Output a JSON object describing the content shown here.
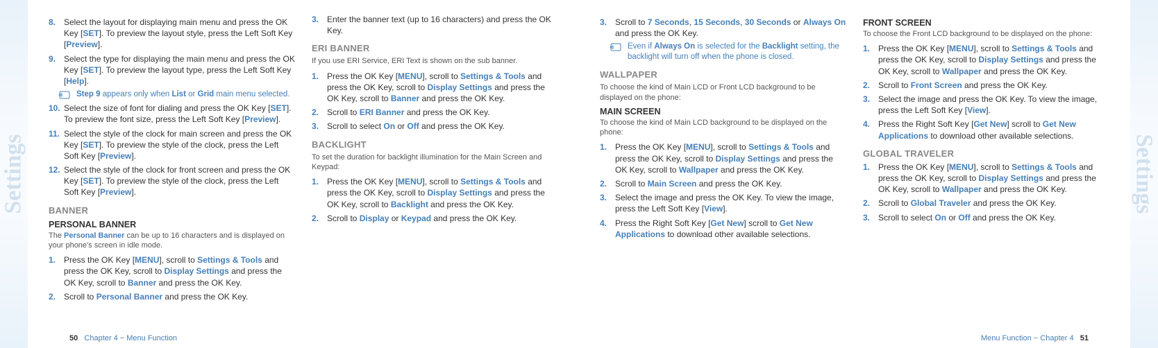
{
  "edgeLabel": "Settings",
  "left": {
    "footerPage": "50",
    "footerText": "Chapter 4 − Menu Function",
    "items": [
      {
        "t": "oli",
        "n": "8.",
        "html": "Select the layout for displaying main menu and press the OK Key [<b class='lk'>SET</b>]. To preview the layout style, press the Left Soft Key [<b class='lk'>Preview</b>]."
      },
      {
        "t": "oli",
        "n": "9.",
        "html": "Select the type for displaying the main menu and press the OK Key [<b class='lk'>SET</b>]. To preview the layout type, press the Left Soft Key [<b class='lk'>Help</b>]."
      },
      {
        "t": "note",
        "html": "<span class='blue'>Step 9</span> appears only when <span class='blue'>List</span> or <span class='blue'>Grid</span> main menu selected."
      },
      {
        "t": "oli",
        "n": "10.",
        "html": "Select the size of font for dialing and press the OK Key [<b class='lk'>SET</b>]. To preview the font size, press the Left Soft Key [<b class='lk'>Preview</b>]."
      },
      {
        "t": "oli",
        "n": "11.",
        "html": "Select the style of the clock for main screen and press the OK Key [<b class='lk'>SET</b>]. To preview the style of the clock, press the Left Soft Key [<b class='lk'>Preview</b>]."
      },
      {
        "t": "oli",
        "n": "12.",
        "html": "Select the style of the clock for front screen and press the OK Key [<b class='lk'>SET</b>]. To preview the style of the clock, press the Left Soft Key [<b class='lk'>Preview</b>]."
      },
      {
        "t": "h1",
        "html": "BANNER"
      },
      {
        "t": "h2",
        "html": "PERSONAL BANNER"
      },
      {
        "t": "sub",
        "html": "The <span class='blue'>Personal Banner</span> can be up to 16 characters and is displayed on your phone's screen in idle mode."
      },
      {
        "t": "oli",
        "n": "1.",
        "html": "Press the OK Key [<b class='lk'>MENU</b>], scroll to <b class='lk'>Settings & Tools</b> and press the OK Key, scroll to <b class='lk'>Display Settings</b> and press the OK Key, scroll to <b class='lk'>Banner</b> and press the OK Key."
      },
      {
        "t": "oli",
        "n": "2.",
        "html": "Scroll to <b class='lk'>Personal Banner</b> and press the OK Key."
      },
      {
        "t": "oli",
        "n": "3.",
        "html": "Enter the banner text (up to 16 characters) and press the OK Key."
      },
      {
        "t": "h1",
        "html": "ERI BANNER"
      },
      {
        "t": "sub",
        "html": "If you use ERI Service, ERI Text is shown on the sub banner."
      },
      {
        "t": "oli",
        "n": "1.",
        "html": "Press the OK Key [<b class='lk'>MENU</b>], scroll to <b class='lk'>Settings & Tools</b> and press the OK Key, scroll to <b class='lk'>Display Settings</b> and press the OK Key, scroll to <b class='lk'>Banner</b> and press the OK Key."
      },
      {
        "t": "oli",
        "n": "2.",
        "html": "Scroll to <b class='lk'>ERI Banner</b> and press the OK Key."
      },
      {
        "t": "oli",
        "n": "3.",
        "html": "Scroll to select <b class='lk'>On</b> or <b class='lk'>Off</b> and press the OK Key."
      },
      {
        "t": "h1",
        "html": "BACKLIGHT"
      },
      {
        "t": "sub",
        "html": "To set the duration for backlight illumination for the Main Screen and Keypad:"
      },
      {
        "t": "oli",
        "n": "1.",
        "html": "Press the OK Key [<b class='lk'>MENU</b>], scroll to <b class='lk'>Settings & Tools</b> and press the OK Key, scroll to <b class='lk'>Display Settings</b> and press the OK Key, scroll to <b class='lk'>Backlight</b> and press the OK Key."
      },
      {
        "t": "oli",
        "n": "2.",
        "html": "Scroll to <b class='lk'>Display</b> or <b class='lk'>Keypad</b> and press the OK Key."
      }
    ]
  },
  "right": {
    "footerPage": "51",
    "footerText": "Menu Function − Chapter 4",
    "items": [
      {
        "t": "oli",
        "n": "3.",
        "html": "Scroll to <b class='lk'>7 Seconds</b>, <b class='lk'>15 Seconds</b>, <b class='lk'>30 Seconds</b> or <b class='lk'>Always On</b> and press the OK Key."
      },
      {
        "t": "note",
        "html": "Even if <span class='blue'>Always On</span> is selected for the <span class='blue'>Backlight</span> setting, the backlight will turn off when the phone is closed."
      },
      {
        "t": "h1",
        "html": "WALLPAPER"
      },
      {
        "t": "sub",
        "html": "To choose the kind of Main LCD or Front LCD background to be displayed on the phone:"
      },
      {
        "t": "h2",
        "html": "MAIN SCREEN"
      },
      {
        "t": "sub",
        "html": "To choose the kind of Main LCD background to be displayed on the phone:"
      },
      {
        "t": "oli",
        "n": "1.",
        "html": "Press the OK Key [<b class='lk'>MENU</b>], scroll to <b class='lk'>Settings & Tools</b> and press the OK Key, scroll to <b class='lk'>Display Settings</b> and press the OK Key, scroll to <b class='lk'>Wallpaper</b> and press the OK Key."
      },
      {
        "t": "oli",
        "n": "2.",
        "html": "Scroll to <b class='lk'>Main Screen</b> and press the OK Key."
      },
      {
        "t": "oli",
        "n": "3.",
        "html": "Select the image and press the OK Key. To view the image, press the Left Soft Key [<b class='lk'>View</b>]."
      },
      {
        "t": "oli",
        "n": "4.",
        "html": "Press the Right Soft Key [<b class='lk'>Get New</b>] scroll to <b class='lk'>Get New Applications</b> to download other available selections."
      },
      {
        "t": "h2",
        "html": "FRONT SCREEN",
        "brk": true
      },
      {
        "t": "sub",
        "html": "To choose the Front LCD background to be displayed on the phone:"
      },
      {
        "t": "oli",
        "n": "1.",
        "html": "Press the OK Key [<b class='lk'>MENU</b>], scroll to <b class='lk'>Settings & Tools</b> and press the OK Key, scroll to <b class='lk'>Display Settings</b> and press the OK Key, scroll to <b class='lk'>Wallpaper</b> and press the OK Key."
      },
      {
        "t": "oli",
        "n": "2.",
        "html": "Scroll to <b class='lk'>Front Screen</b> and press the OK Key."
      },
      {
        "t": "oli",
        "n": "3.",
        "html": "Select the image and press the OK Key. To view the image, press the Left Soft Key [<b class='lk'>View</b>]."
      },
      {
        "t": "oli",
        "n": "4.",
        "html": "Press the Right Soft Key [<b class='lk'>Get New</b>] scroll to <b class='lk'>Get New Applications</b> to download other available selections."
      },
      {
        "t": "h1",
        "html": "GLOBAL TRAVELER"
      },
      {
        "t": "oli",
        "n": "1.",
        "html": "Press the OK Key [<b class='lk'>MENU</b>], scroll to <b class='lk'>Settings & Tools</b> and press the OK Key, scroll to <b class='lk'>Display Settings</b> and press the OK Key, scroll to <b class='lk'>Wallpaper</b> and press the OK Key."
      },
      {
        "t": "oli",
        "n": "2.",
        "html": "Scroll to <b class='lk'>Global Traveler</b> and press the OK Key."
      },
      {
        "t": "oli",
        "n": "3.",
        "html": "Scroll to select <b class='lk'>On</b> or <b class='lk'>Off</b> and press the OK Key."
      }
    ]
  }
}
